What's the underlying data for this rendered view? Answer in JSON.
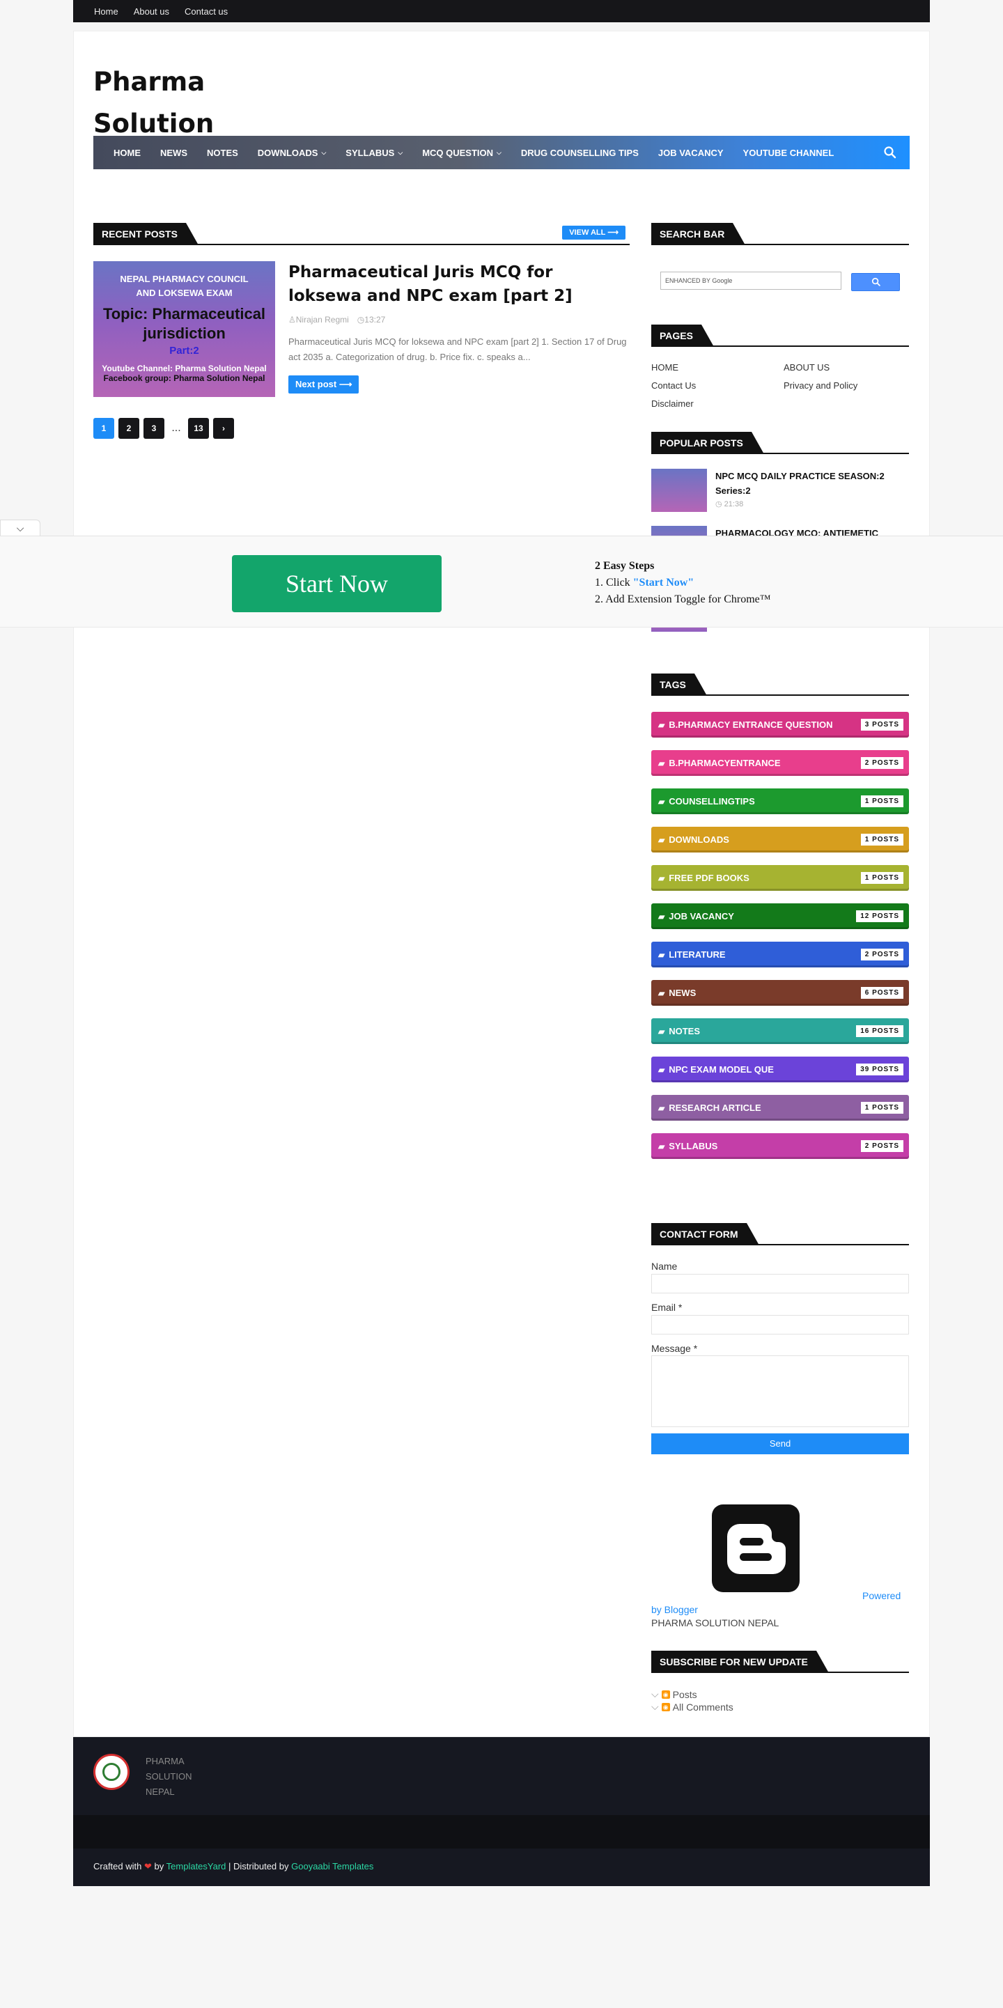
{
  "topbar": {
    "links": [
      "Home",
      "About us",
      "Contact us"
    ]
  },
  "brand": {
    "line1": "Pharma",
    "line2": "Solution"
  },
  "nav": {
    "items": [
      {
        "label": "HOME",
        "dropdown": false
      },
      {
        "label": "NEWS",
        "dropdown": false
      },
      {
        "label": "NOTES",
        "dropdown": false
      },
      {
        "label": "DOWNLOADS",
        "dropdown": true
      },
      {
        "label": "SYLLABUS",
        "dropdown": true
      },
      {
        "label": "MCQ QUESTION",
        "dropdown": true
      },
      {
        "label": "DRUG COUNSELLING TIPS",
        "dropdown": false
      },
      {
        "label": "JOB VACANCY",
        "dropdown": false
      },
      {
        "label": "YOUTUBE CHANNEL",
        "dropdown": false
      }
    ],
    "search_icon": "search-icon"
  },
  "recent": {
    "heading": "RECENT POSTS",
    "view_all": "VIEW ALL",
    "post": {
      "thumb": {
        "line1": "NEPAL PHARMACY COUNCIL",
        "line2": "AND LOKSEWA  EXAM",
        "topic": "Topic: Pharmaceutical",
        "topic2": "jurisdiction",
        "part": "Part:2",
        "yt": "Youtube Channel: Pharma Solution Nepal",
        "fb": "Facebook group: Pharma Solution Nepal"
      },
      "title": "Pharmaceutical Juris MCQ for loksewa and NPC exam [part 2]",
      "author": "Nirajan Regmi",
      "time": "13:27",
      "snippet": "Pharmaceutical Juris MCQ for loksewa and NPC exam  [part 2]  1. Section 17 of Drug act 2035   a. Categorization of drug.  b. Price fix.  c. speaks a...",
      "next_label": "Next post"
    },
    "pager": {
      "pages": [
        "1",
        "2",
        "3"
      ],
      "dots": "...",
      "last": "13"
    }
  },
  "sidebar": {
    "search": {
      "heading": "SEARCH BAR",
      "placeholder": "ENHANCED BY Google"
    },
    "pages": {
      "heading": "PAGES",
      "links": [
        "HOME",
        "ABOUT US",
        "Contact Us",
        "Privacy and Policy",
        "Disclaimer"
      ]
    },
    "popular": {
      "heading": "POPULAR POSTS",
      "items": [
        {
          "title": "NPC MCQ DAILY PRACTICE SEASON:2 Series:2",
          "time": "21:38"
        },
        {
          "title": "PHARMACOLOGY MCQ: ANTIEMETIC",
          "time": ""
        }
      ]
    },
    "tags": {
      "heading": "TAGS",
      "items": [
        {
          "label": "B.PHARMACY ENTRANCE QUESTION",
          "count": "3 POSTS",
          "color": "#d63384"
        },
        {
          "label": "B.PHARMACYENTRANCE",
          "count": "2 POSTS",
          "color": "#e83e8c"
        },
        {
          "label": "COUNSELLINGTIPS",
          "count": "1 POSTS",
          "color": "#1c9a2e"
        },
        {
          "label": "DOWNLOADS",
          "count": "1 POSTS",
          "color": "#d69e1e"
        },
        {
          "label": "FREE PDF BOOKS",
          "count": "1 POSTS",
          "color": "#a6b331"
        },
        {
          "label": "JOB VACANCY",
          "count": "12 POSTS",
          "color": "#137a1a"
        },
        {
          "label": "LITERATURE",
          "count": "2 POSTS",
          "color": "#2f5ed8"
        },
        {
          "label": "NEWS",
          "count": "6 POSTS",
          "color": "#7a3b2a"
        },
        {
          "label": "NOTES",
          "count": "16 POSTS",
          "color": "#2aa79b"
        },
        {
          "label": "NPC EXAM MODEL QUE",
          "count": "39 POSTS",
          "color": "#6b43d9"
        },
        {
          "label": "RESEARCH ARTICLE",
          "count": "1 POSTS",
          "color": "#8e5fa2"
        },
        {
          "label": "SYLLABUS",
          "count": "2 POSTS",
          "color": "#c43ea8"
        }
      ]
    },
    "contact": {
      "heading": "CONTACT FORM",
      "name_label": "Name",
      "email_label": "Email",
      "message_label": "Message",
      "required_mark": "*",
      "send_label": "Send"
    },
    "powered": {
      "text1": "Powered",
      "text2": "by Blogger",
      "site": "PHARMA SOLUTION NEPAL"
    },
    "subscribe": {
      "heading": "SUBSCRIBE FOR NEW UPDATE",
      "posts": "Posts",
      "comments": "All Comments"
    }
  },
  "footer": {
    "name": "PHARMA SOLUTION NEPAL",
    "crafted": "Crafted with",
    "by": "by",
    "templates_yard": "TemplatesYard",
    "distributed": "| Distributed by",
    "gooyaabi": "Gooyaabi Templates"
  },
  "ad": {
    "button_label": "Start Now",
    "steps_title": "2 Easy Steps",
    "step1_prefix": "1. Click ",
    "step1_link": "\"Start Now\"",
    "step2": "2. Add Extension Toggle for Chrome™"
  }
}
